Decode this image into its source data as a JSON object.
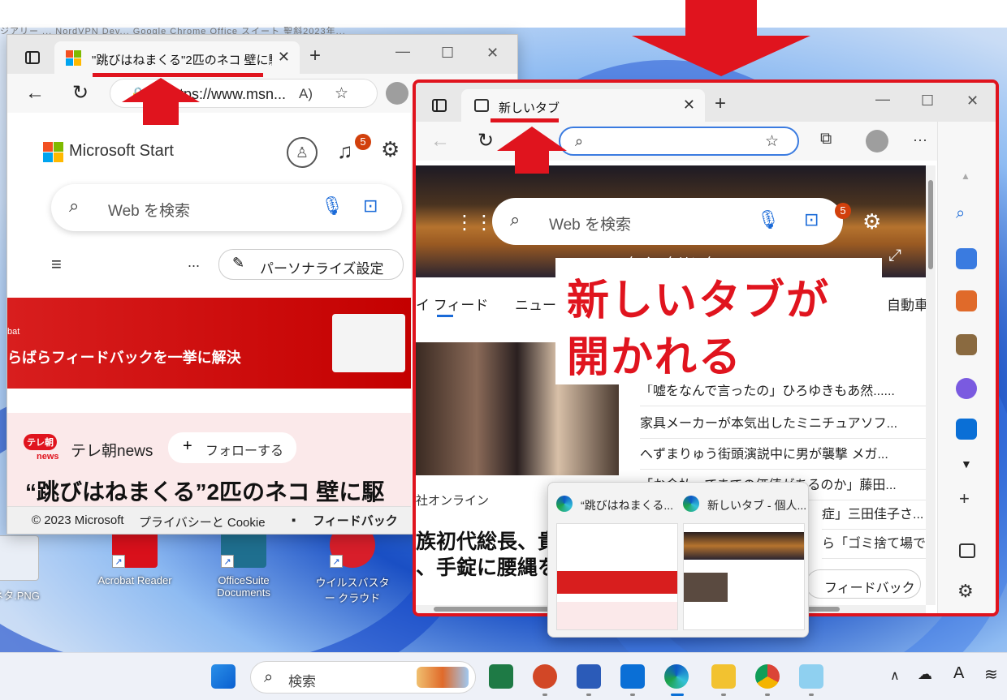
{
  "desktop": {
    "ghost_text": "ジアリー ...  NordVPN  Dev...  Google Chrome  Office スイート  聖斜2023年...",
    "icons": [
      {
        "label": "ネタ.PNG"
      },
      {
        "label": "Acrobat Reader"
      },
      {
        "label": "OfficeSuite Documents"
      },
      {
        "label": "ウイルスバスター クラウド"
      }
    ]
  },
  "window1": {
    "tab_title": "\"跳びはねまくる\"2匹のネコ 壁に駆け上がる",
    "address": "https://www.msn...",
    "read_aloud": "A)",
    "brand": "Microsoft Start",
    "notification_count": "5",
    "search_placeholder": "Web を検索",
    "menu_more": "...",
    "personalize_button": "パーソナライズ設定",
    "banner_small": "bat",
    "banner_text": "らばらフィードバックを一挙に解決",
    "source_name": "テレ朝news",
    "source_logo_top": "テレ朝",
    "source_logo_bottom": "news",
    "follow_button": "フォローする",
    "headline": "“跳びはねまくる”2匹のネコ 壁に駆",
    "footer_copyright": "© 2023 Microsoft",
    "footer_privacy": "プライバシーと Cookie",
    "footer_feedback": "フィードバック"
  },
  "window2": {
    "tab_title": "新しいタブ",
    "search_placeholder": "Web を検索",
    "notification_count": "5",
    "quicklinks": "クイックリンク",
    "nav_tabs": [
      "イ フィード",
      "ニュー",
      "自動車"
    ],
    "source": "社オンライン",
    "headline_line1": "族初代総長、貴",
    "headline_line2": "、手錠に腰縄を",
    "news_items": [
      "「嘘をなんで言ったの」ひろゆきもあ然......",
      "家具メーカーが本気出したミニチュアソフ...",
      "へずまりゅう街頭演説中に男が襲撃 メガ...",
      "「お金払ってまでの価値があるのか」藤田...",
      "症」三田佳子さ...",
      "ら「ゴミ捨て場で..."
    ],
    "feedback_button": "フィードバック",
    "more_menu": "···"
  },
  "overlay": {
    "line1": "新しいタブが",
    "line2": "開かれる"
  },
  "thumbnails": [
    {
      "title": "“跳びはねまくる..."
    },
    {
      "title": "新しいタブ - 個人..."
    }
  ],
  "taskbar": {
    "search_label": "検索",
    "tray_a": "A"
  },
  "colors": {
    "accent_red": "#e0141e",
    "edge_blue": "#0a6fd6"
  }
}
